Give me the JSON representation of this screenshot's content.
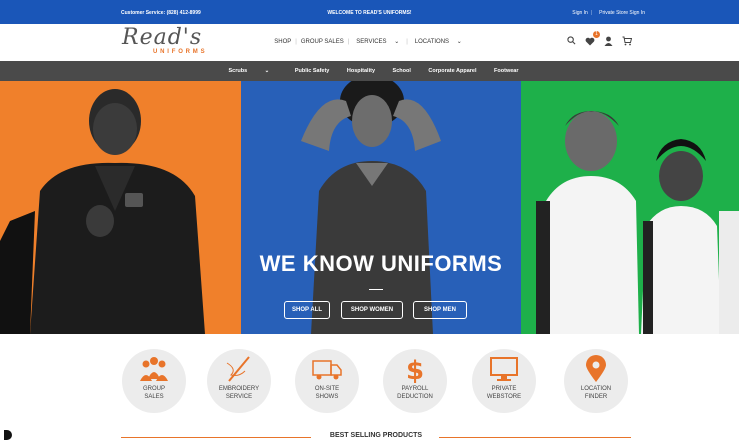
{
  "topbar": {
    "customer_service": "Customer Service: (828) 412-8999",
    "welcome": "WELCOME TO READ'S UNIFORMS!",
    "sign_in": "Sign In",
    "private_store": "Private Store Sign In"
  },
  "logo": {
    "script": "Read's",
    "sub": "UNIFORMS"
  },
  "mainnav": {
    "items": [
      "SHOP",
      "GROUP SALES",
      "SERVICES",
      "LOCATIONS"
    ]
  },
  "header_icons": {
    "wishlist_count": "1"
  },
  "catnav": {
    "items": [
      "Scrubs",
      "Public Safety",
      "Hospitality",
      "School",
      "Corporate Apparel",
      "Footwear"
    ]
  },
  "hero": {
    "title": "WE KNOW UNIFORMS",
    "buttons": [
      "SHOP ALL",
      "SHOP WOMEN",
      "SHOP MEN"
    ]
  },
  "services": [
    {
      "line1": "GROUP",
      "line2": "SALES",
      "icon": "group-icon"
    },
    {
      "line1": "EMBROIDERY",
      "line2": "SERVICE",
      "icon": "needle-icon"
    },
    {
      "line1": "ON-SITE",
      "line2": "SHOWS",
      "icon": "truck-icon"
    },
    {
      "line1": "PAYROLL",
      "line2": "DEDUCTION",
      "icon": "dollar-icon"
    },
    {
      "line1": "PRIVATE",
      "line2": "WEBSTORE",
      "icon": "monitor-icon"
    },
    {
      "line1": "LOCATION",
      "line2": "FINDER",
      "icon": "map-pin-icon"
    }
  ],
  "best_selling": "BEST SELLING PRODUCTS",
  "colors": {
    "brand_blue": "#1a56b8",
    "accent_orange": "#e8742a",
    "catnav_gray": "#4a4a4a",
    "green": "#1eb04a"
  }
}
